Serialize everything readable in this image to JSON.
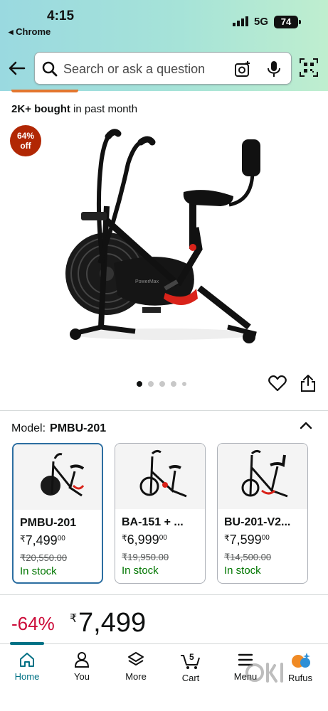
{
  "status_bar": {
    "time": "4:15",
    "back_app": "◂ Chrome",
    "network": "5G",
    "battery": "74"
  },
  "search": {
    "placeholder": "Search or ask a question"
  },
  "product": {
    "bought_bold": "2K+ bought",
    "bought_rest": " in past month",
    "discount_badge_line1": "64%",
    "discount_badge_line2": "off",
    "image_count": 5,
    "active_image": 1
  },
  "model": {
    "label": "Model:",
    "value": "PMBU-201"
  },
  "variants": [
    {
      "name": "PMBU-201",
      "price_currency": "₹",
      "price_whole": "7,499",
      "price_fraction": "00",
      "mrp": "₹20,550.00",
      "stock": "In stock",
      "selected": true
    },
    {
      "name": "BA-151 + ...",
      "price_currency": "₹",
      "price_whole": "6,999",
      "price_fraction": "00",
      "mrp": "₹19,950.00",
      "stock": "In stock",
      "selected": false
    },
    {
      "name": "BU-201-V2...",
      "price_currency": "₹",
      "price_whole": "7,599",
      "price_fraction": "00",
      "mrp": "₹14,500.00",
      "stock": "In stock",
      "selected": false
    }
  ],
  "price": {
    "discount": "-64%",
    "currency": "₹",
    "amount": "7,499"
  },
  "nav": [
    {
      "label": "Home",
      "icon": "home-icon",
      "active": true
    },
    {
      "label": "You",
      "icon": "person-icon",
      "active": false
    },
    {
      "label": "More",
      "icon": "layers-icon",
      "active": false
    },
    {
      "label": "Cart",
      "icon": "cart-icon",
      "active": false,
      "badge": "5"
    },
    {
      "label": "Menu",
      "icon": "menu-icon",
      "active": false
    },
    {
      "label": "Rufus",
      "icon": "rufus-icon",
      "active": false
    }
  ],
  "colors": {
    "accent": "#007185",
    "price_red": "#cc0c39",
    "badge_red": "#b12704",
    "stock_green": "#007600",
    "selected_border": "#2c6ea1"
  }
}
